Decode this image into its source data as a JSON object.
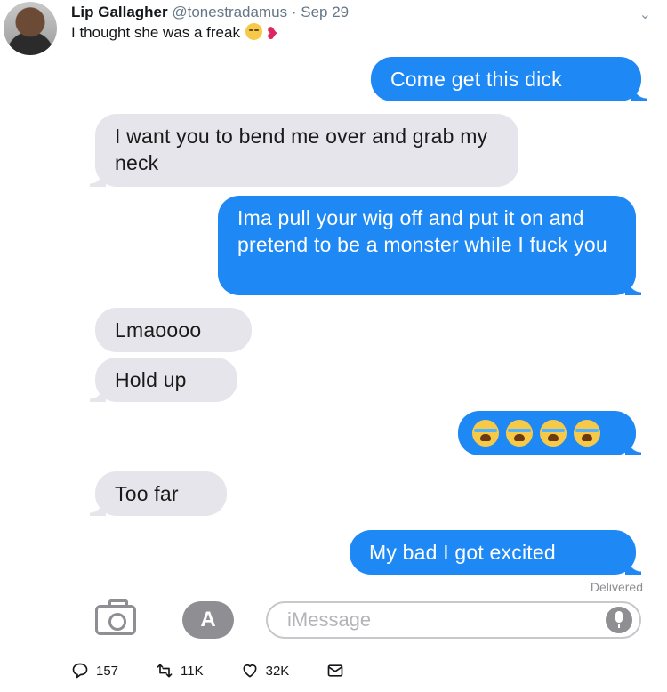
{
  "tweet": {
    "author_name": "Lip Gallagher",
    "handle": "@tonestradamus",
    "separator": "·",
    "date": "Sep 29",
    "text": "I thought she was a freak",
    "more_glyph": "⌄"
  },
  "conversation": {
    "messages": [
      {
        "side": "sent",
        "text": "Come get this dick"
      },
      {
        "side": "received",
        "text": "I want you to bend me over and grab my neck"
      },
      {
        "side": "sent",
        "text": "Ima pull your wig off and put it on and pretend to be a monster while I fuck you"
      },
      {
        "side": "received",
        "text": "Lmaoooo"
      },
      {
        "side": "received",
        "text": "Hold up"
      },
      {
        "side": "sent",
        "emoji": [
          "crying-laughing",
          "crying-laughing",
          "crying-laughing",
          "crying-laughing"
        ]
      },
      {
        "side": "received",
        "text": "Too far"
      },
      {
        "side": "sent",
        "text": "My bad I got excited"
      }
    ],
    "delivered_label": "Delivered",
    "input_placeholder": "iMessage",
    "appstore_glyph": "A"
  },
  "actions": {
    "replies": "157",
    "retweets": "11K",
    "likes": "32K"
  },
  "colors": {
    "sent_bubble": "#1e88f5",
    "received_bubble": "#e6e5eb",
    "icon_gray": "#8e8e93"
  }
}
